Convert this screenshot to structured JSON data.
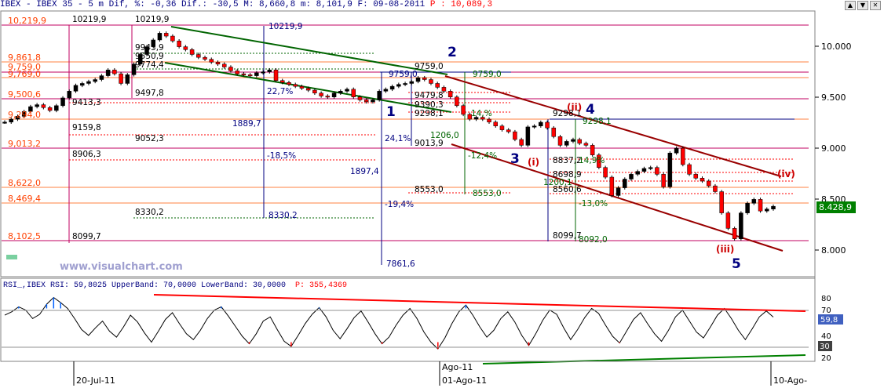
{
  "header": {
    "title": "IBEX - IBEX 35 -  5 m Dif, %: -0,36 Dif.: -30,5 M: 8,660,8 m: 8,101,9 F: 09-08-2011",
    "p_value": "P : 10,089,3"
  },
  "window_buttons": [
    "▲",
    "▼",
    "✕"
  ],
  "colors": {
    "price_up": "#000000",
    "price_down": "#ff0000",
    "green_channel": "#006400",
    "red_channel": "#990000",
    "blue_measure": "#000080",
    "fib_orange": "#ff8040",
    "fib_magenta": "#c00060"
  },
  "watermark": "www.visualchart.com",
  "price_axis": {
    "ticks": [
      "10.000",
      "9.500",
      "9.000",
      "8.500",
      "8.000"
    ],
    "current_label": "8.428,9"
  },
  "left_levels": [
    "10,219,9",
    "9,861,8",
    "9,759,0",
    "9,769,0",
    "9,500,6",
    "9,294,0",
    "9,013,2",
    "8,622,0",
    "8,469,4",
    "8,102,5"
  ],
  "plot_labels": [
    "10219,9",
    "10219,9",
    "9943,9",
    "9550,9",
    "9774,4",
    "9497,8",
    "9413,3",
    "9159,8",
    "9052,3",
    "8906,3",
    "8330,2",
    "8099,7",
    "1889,7",
    "22,7%",
    "-18,5%",
    "24,1%",
    "1897,4",
    "-19,4%",
    "9759,0",
    "9759,0",
    "9479,8",
    "9390,3",
    "9298,1",
    "9013,9",
    "1206,0",
    "-12,4%",
    "8553,0",
    "8553,0",
    "9759,0",
    "14,%",
    "9298,1",
    "9298,1",
    "8837,2",
    "14,9%",
    "8698,9",
    "8560,6",
    "1200,1",
    "-13,0%",
    "8099,7",
    "8092,0",
    "8330,2",
    "7861,6",
    "10219,9"
  ],
  "waves": {
    "w1": "1",
    "w2": "2",
    "w3": "3",
    "w4": "4",
    "w5": "5",
    "wi": "(i)",
    "wii": "(ii)",
    "wiii": "(iii)",
    "wiv": "(iv)"
  },
  "rsi": {
    "title": "RSI_,IBEX RSI: 59,8025 UpperBand: 70,0000 LowerBand: 30,0000",
    "p_value": "P: 355,4369",
    "ticks": [
      "80",
      "70",
      "60",
      "40",
      "30",
      "20"
    ],
    "value_label": "59,8",
    "low_label": "30"
  },
  "time_axis": {
    "labels": [
      "20-Jul-11",
      "Ago-11",
      "01-Ago-11",
      "10-Ago-"
    ]
  },
  "chart_data": {
    "type": "candlestick",
    "timeframe": "5 m",
    "x": [
      "20-Jul-11",
      "01-Ago-11",
      "10-Ago-"
    ],
    "ylim": [
      7700,
      10450
    ],
    "series": [
      {
        "values": [
          9300,
          9330,
          9360,
          9410,
          9460,
          9480,
          9450,
          9420,
          9470,
          9550,
          9620,
          9680,
          9700,
          9720,
          9740,
          9780,
          9840,
          9800,
          9700,
          9790,
          9900,
          10000,
          10080,
          10150,
          10219.9,
          10190,
          10140,
          10080,
          10050,
          10000,
          9970,
          9950,
          9920,
          9900,
          9870,
          9830,
          9800,
          9790,
          9780,
          9810,
          9820,
          9840,
          9730,
          9710,
          9690,
          9670,
          9650,
          9630,
          9600,
          9570,
          9560,
          9600,
          9620,
          9640,
          9560,
          9530,
          9510,
          9530,
          9620,
          9640,
          9670,
          9690,
          9700,
          9720,
          9759,
          9740,
          9700,
          9660,
          9620,
          9560,
          9470,
          9380,
          9330,
          9350,
          9330,
          9300,
          9260,
          9220,
          9200,
          9120,
          9060,
          9250,
          9260,
          9298.1,
          9240,
          9150,
          9060,
          9100,
          9120,
          9080,
          9060,
          8960,
          8830,
          8730,
          8540,
          8620,
          8710,
          8760,
          8790,
          8820,
          8830,
          8760,
          8630,
          8980,
          9030,
          8860,
          8760,
          8720,
          8690,
          8640,
          8580,
          8360,
          8200,
          8092,
          8360,
          8460,
          8500,
          8380,
          8400,
          8428.9
        ]
      },
      {
        "name": "RSI",
        "values": [
          62,
          66,
          72,
          68,
          58,
          63,
          75,
          83,
          77,
          70,
          58,
          45,
          38,
          47,
          55,
          43,
          36,
          48,
          62,
          54,
          41,
          30,
          43,
          57,
          65,
          52,
          40,
          33,
          44,
          58,
          68,
          72,
          61,
          49,
          37,
          28,
          40,
          55,
          60,
          45,
          31,
          25,
          38,
          52,
          63,
          71,
          60,
          44,
          34,
          46,
          59,
          67,
          54,
          40,
          28,
          36,
          50,
          62,
          70,
          58,
          42,
          30,
          22,
          35,
          52,
          66,
          74,
          62,
          48,
          36,
          44,
          58,
          66,
          54,
          38,
          26,
          40,
          56,
          68,
          63,
          47,
          33,
          45,
          59,
          70,
          64,
          50,
          37,
          29,
          43,
          57,
          65,
          52,
          40,
          31,
          44,
          60,
          68,
          55,
          42,
          35,
          48,
          62,
          70,
          58,
          44,
          33,
          46,
          60,
          67,
          59.8
        ]
      }
    ],
    "upper_band": 70,
    "lower_band": 30,
    "rsi_ylim": [
      10,
      90
    ]
  }
}
